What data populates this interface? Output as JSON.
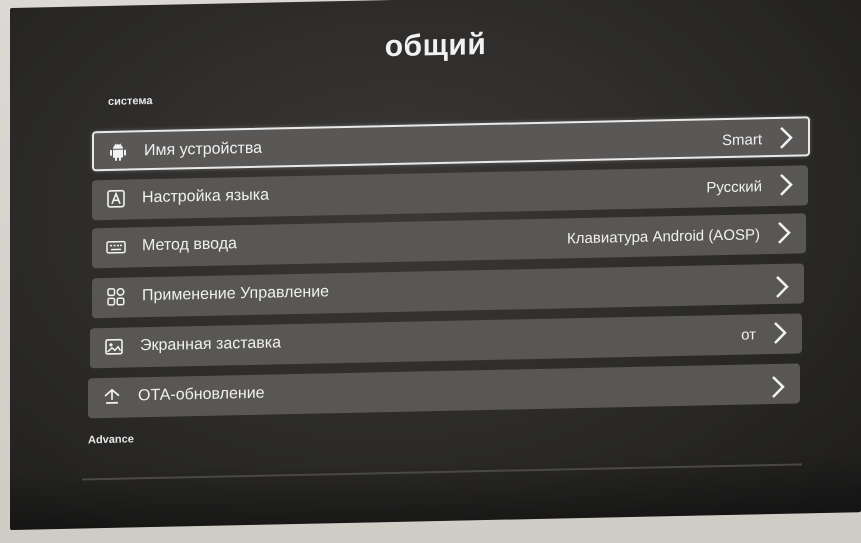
{
  "screen": {
    "title": "общий",
    "section_system": "система",
    "section_advance": "Advance"
  },
  "settings": [
    {
      "label": "Имя устройства",
      "value": "Smart",
      "icon": "android-icon"
    },
    {
      "label": "Настройка языка",
      "value": "Русский",
      "icon": "language-icon"
    },
    {
      "label": "Метод ввода",
      "value": "Клавиатура Android (AOSP)",
      "icon": "keyboard-icon"
    },
    {
      "label": "Применение Управление",
      "value": "",
      "icon": "apps-grid-icon"
    },
    {
      "label": "Экранная заставка",
      "value": "от",
      "icon": "screensaver-image-icon"
    },
    {
      "label": "ОТА-обновление",
      "value": "",
      "icon": "ota-update-icon"
    }
  ]
}
